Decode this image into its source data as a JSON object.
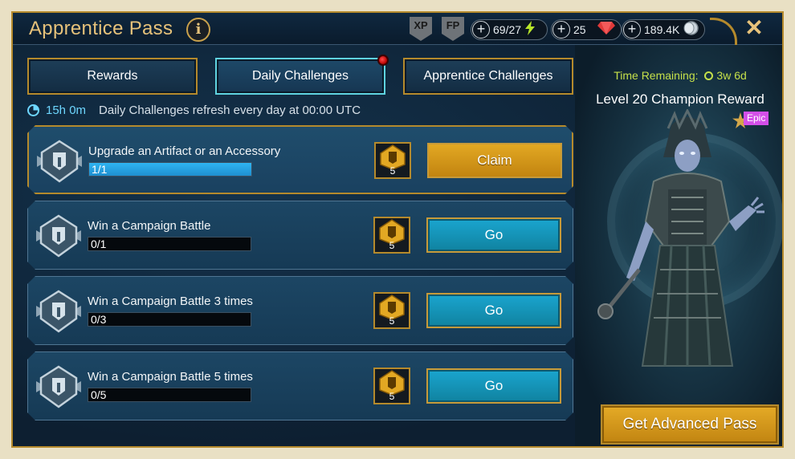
{
  "header": {
    "title": "Apprentice Pass",
    "info_label": "i",
    "badges": [
      "XP",
      "FP"
    ],
    "resources": [
      {
        "name": "energy",
        "value": "69/27",
        "icon": "lightning-icon",
        "color": "#b7e52a"
      },
      {
        "name": "gems",
        "value": "25",
        "icon": "ruby-icon",
        "color": "#e03a3a"
      },
      {
        "name": "silver",
        "value": "189.4K",
        "icon": "silver-coin-icon",
        "color": "#c9d3da"
      }
    ],
    "close_label": "✕"
  },
  "tabs": [
    {
      "label": "Rewards",
      "active": false
    },
    {
      "label": "Daily Challenges",
      "active": true,
      "notification": true
    },
    {
      "label": "Apprentice Challenges",
      "active": false
    }
  ],
  "refresh": {
    "time": "15h 0m",
    "text": "Daily Challenges refresh every day at 00:00 UTC"
  },
  "challenges": [
    {
      "title": "Upgrade an Artifact or an Accessory",
      "progress_text": "1/1",
      "progress": 1.0,
      "reward_count": "5",
      "action": "Claim",
      "completed": true
    },
    {
      "title": "Win a Campaign Battle",
      "progress_text": "0/1",
      "progress": 0.0,
      "reward_count": "5",
      "action": "Go",
      "completed": false
    },
    {
      "title": "Win a Campaign Battle 3 times",
      "progress_text": "0/3",
      "progress": 0.0,
      "reward_count": "5",
      "action": "Go",
      "completed": false
    },
    {
      "title": "Win a Campaign Battle 5 times",
      "progress_text": "0/5",
      "progress": 0.0,
      "reward_count": "5",
      "action": "Go",
      "completed": false
    }
  ],
  "right_panel": {
    "time_remaining_label": "Time Remaining:",
    "time_remaining_value": "3w 6d",
    "reward_title": "Level 20 Champion Reward",
    "rarity": "Epic",
    "advanced_button": "Get Advanced Pass"
  },
  "colors": {
    "gold": "#b58a2c",
    "accent_cyan": "#6ed7ff",
    "claim": "#d99a1a",
    "go": "#1aa5cf",
    "epic": "#d34fe8",
    "time_green": "#c5e04a"
  }
}
